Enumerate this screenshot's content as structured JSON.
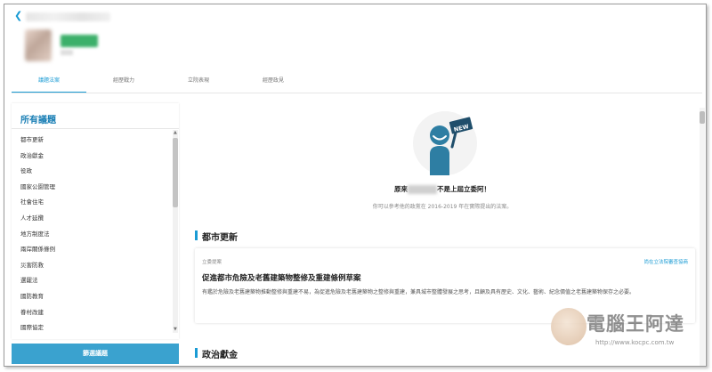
{
  "header": {
    "back_icon": "chevron-left-icon"
  },
  "tabs": [
    {
      "label": "議題法案",
      "active": true
    },
    {
      "label": "經歷戰力",
      "active": false
    },
    {
      "label": "立院表現",
      "active": false
    },
    {
      "label": "經歷政見",
      "active": false
    }
  ],
  "sidebar": {
    "title": "所有議題",
    "items": [
      "都市更新",
      "政治獻金",
      "役政",
      "國家公園管理",
      "社會住宅",
      "人才延攬",
      "地方制度法",
      "兩岸關係條例",
      "災害防救",
      "選罷法",
      "國防教育",
      "眷村改建",
      "國際協定"
    ],
    "button_label": "篩選議題"
  },
  "main": {
    "hero_title_prefix": "原來",
    "hero_title_suffix": "不是上屆立委阿！",
    "hero_subtitle": "你可以參考他的政黨在 2016-2019 年在實際提出的法案。",
    "hero_badge": "NEW",
    "sections": [
      {
        "title": "都市更新"
      },
      {
        "title": "政治獻金"
      }
    ],
    "card": {
      "tag": "立委提案",
      "status": "尚在立法院審查協商",
      "title": "促進都市危險及老舊建築物整修及重建條例草案",
      "description": "有鑑於危險及老舊建築物推動整修與重建不易，為促進危險及老舊建築物之整修與重建，兼具城市整體發展之思考，且顧及具有歷史、文化、藝術、紀念價值之老舊建築物保存之必要。"
    }
  },
  "watermark": {
    "text": "電腦王阿達",
    "url": "http://www.kocpc.com.tw"
  },
  "colors": {
    "accent": "#1a9bd4",
    "button": "#3aa2cf",
    "sidebar_title": "#1a7fb5"
  }
}
